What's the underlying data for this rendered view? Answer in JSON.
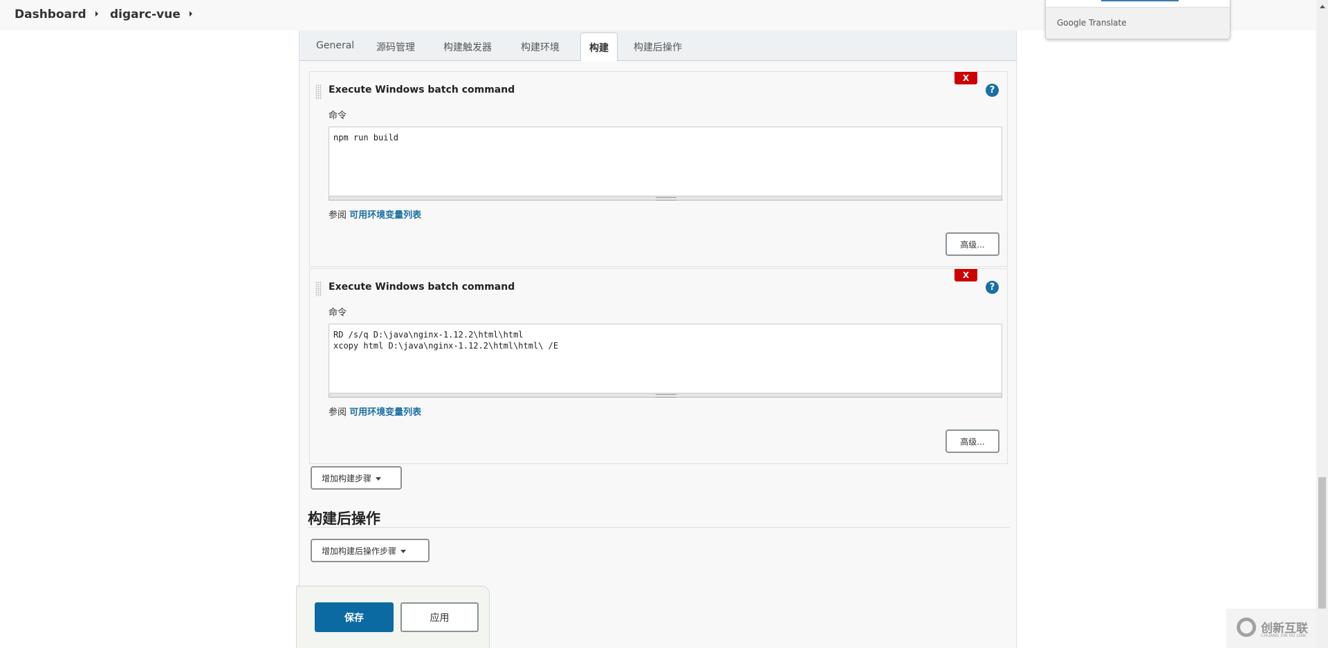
{
  "breadcrumb": [
    "Dashboard",
    "digarc-vue"
  ],
  "tabs": [
    "General",
    "源码管理",
    "构建触发器",
    "构建环境",
    "构建",
    "构建后操作"
  ],
  "active_tab": "构建",
  "steps": [
    {
      "title": "Execute Windows batch command",
      "label": "命令",
      "command": "npm run build",
      "see": "参阅",
      "env_link": "可用环境变量列表",
      "advanced": "高级...",
      "delete": "X",
      "help": "?"
    },
    {
      "title": "Execute Windows batch command",
      "label": "命令",
      "command": "RD /s/q D:\\java\\nginx-1.12.2\\html\\html\nxcopy html D:\\java\\nginx-1.12.2\\html\\html\\ /E",
      "see": "参阅",
      "env_link": "可用环境变量列表",
      "advanced": "高级...",
      "delete": "X",
      "help": "?"
    }
  ],
  "add_build_step": "增加构建步骤",
  "post_build_heading": "构建后操作",
  "add_post_build_step": "增加构建后操作步骤",
  "footer": {
    "save": "保存",
    "apply": "应用"
  },
  "google_translate": "Google Translate",
  "watermark": {
    "name": "创新互联",
    "sub": "CHUANG XIN HU LIAN"
  },
  "colors": {
    "primary": "#0b6aa2",
    "danger": "#cc0000",
    "link": "#1a6fa3"
  }
}
